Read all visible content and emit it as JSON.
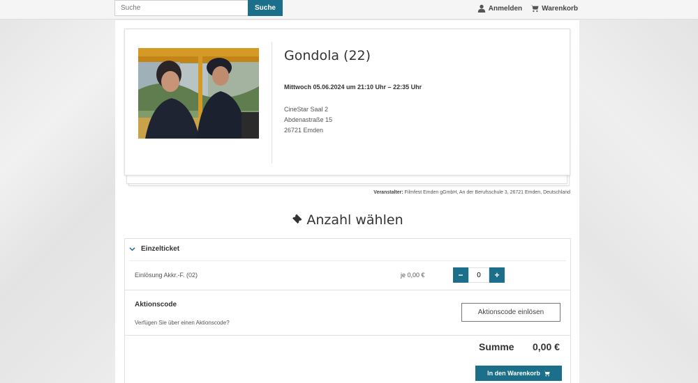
{
  "search": {
    "placeholder": "Suche",
    "button_label": "Suche"
  },
  "nav": {
    "login_label": "Anmelden",
    "cart_label": "Warenkorb"
  },
  "event": {
    "title": "Gondola (22)",
    "datetime": "Mittwoch 05.06.2024 um 21:10 Uhr – 22:35 Uhr",
    "venue_line1": "CineStar Saal 2",
    "venue_line2": "Abdenastraße 15",
    "venue_line3": "26721 Emden"
  },
  "organizer": {
    "label": "Veranstalter:",
    "text": "Filmfest Emden gGmbH, An der Berufsschule 3, 26721 Emden, Deutschland"
  },
  "section": {
    "title": "Anzahl wählen"
  },
  "ticket": {
    "category": "Einzelticket",
    "name": "Einlösung Akkr.-F. (02)",
    "price": "je 0,00 €",
    "quantity": "0",
    "minus": "−",
    "plus": "+"
  },
  "promo": {
    "title": "Aktionscode",
    "question": "Verfügen Sie über einen Aktionscode?",
    "button_label": "Aktionscode einlösen"
  },
  "summary": {
    "label": "Summe",
    "value": "0,00 €"
  },
  "cart_button": {
    "label": "In den Warenkorb"
  },
  "colors": {
    "accent": "#1b6f8a"
  },
  "icons": {
    "user": "user-icon",
    "cart": "cart-icon",
    "ticket": "ticket-icon",
    "chevron": "chevron-down-icon"
  }
}
